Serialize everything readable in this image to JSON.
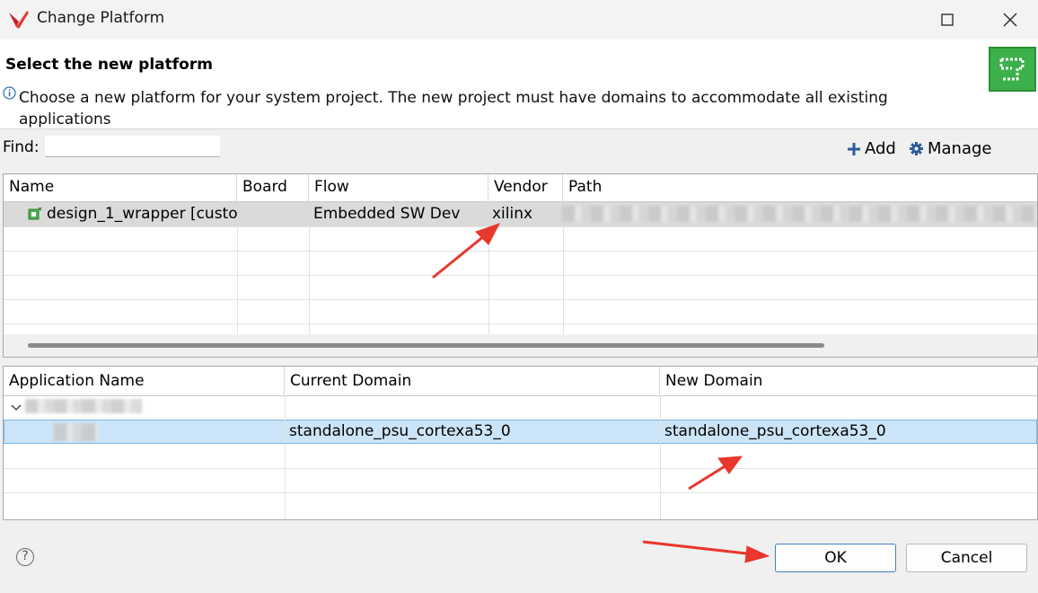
{
  "window": {
    "title": "Change Platform",
    "maximize_icon": "maximize-icon",
    "close_icon": "close-icon"
  },
  "header": {
    "title": "Select the new platform",
    "description": "Choose a new platform for your system project. The new project must have domains to accommodate all existing applications"
  },
  "toolbar": {
    "find_label": "Find:",
    "find_value": "",
    "add_label": "Add",
    "manage_label": "Manage"
  },
  "platform_table": {
    "columns": [
      "Name",
      "Board",
      "Flow",
      "Vendor",
      "Path"
    ],
    "rows": [
      {
        "name": "design_1_wrapper [custo",
        "board": "",
        "flow": "Embedded SW Dev",
        "vendor": "xilinx",
        "path": ""
      }
    ]
  },
  "app_table": {
    "columns": [
      "Application Name",
      "Current Domain",
      "New Domain"
    ],
    "rows": [
      {
        "application": "",
        "current_domain": "standalone_psu_cortexa53_0",
        "new_domain": "standalone_psu_cortexa53_0"
      }
    ]
  },
  "buttons": {
    "help": "?",
    "ok": "OK",
    "cancel": "Cancel"
  },
  "colors": {
    "selection": "#cce4f7",
    "annotation_arrow": "#e8372c",
    "wizard_green": "#3cb04a"
  }
}
